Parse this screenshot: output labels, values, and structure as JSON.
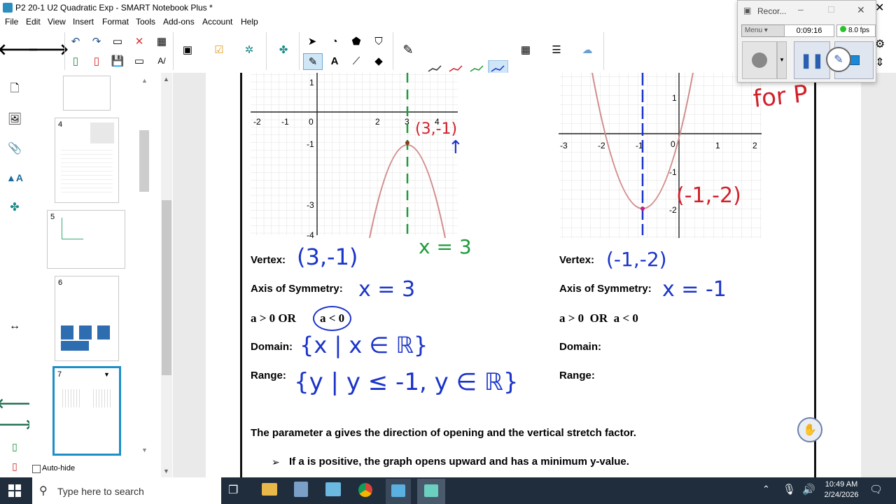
{
  "window": {
    "title": "P2 20-1 U2 Quadratic Exp - SMART Notebook Plus *",
    "close": "✕"
  },
  "menu": [
    "File",
    "Edit",
    "View",
    "Insert",
    "Format",
    "Tools",
    "Add-ons",
    "Account",
    "Help"
  ],
  "recorder": {
    "title": "Recor...",
    "menu_label": "Menu",
    "time": "0:09:16",
    "fps": "8.0 fps"
  },
  "sorter": {
    "pages": [
      {
        "num": "4"
      },
      {
        "num": "5"
      },
      {
        "num": "6"
      },
      {
        "num": "7"
      }
    ],
    "autohide": "Auto-hide"
  },
  "graph1": {
    "x_ticks": [
      "-2",
      "-1",
      "0",
      "2",
      "3",
      "4"
    ],
    "y_ticks": [
      "1",
      "-1",
      "-3",
      "-4"
    ],
    "vertex_ann": "(3,-1)",
    "axis_ann": "x = 3"
  },
  "graph2": {
    "x_ticks": [
      "-3",
      "-2",
      "-1",
      "0",
      "1",
      "2"
    ],
    "y_ticks": [
      "1",
      "-1",
      "-2"
    ],
    "vertex_ann": "(-1,-2)"
  },
  "left": {
    "vertex_label": "Vertex:",
    "vertex_value": "(3,-1)",
    "axis_label": "Axis of Symmetry:",
    "axis_value": "x = 3",
    "a_text": "a > 0  OR",
    "a_circled": "a < 0",
    "domain_label": "Domain:",
    "domain_value": "{x | x ∈ ℝ}",
    "range_label": "Range:",
    "range_value": "{y | y ≤ -1, y ∈ ℝ}"
  },
  "right": {
    "vertex_label": "Vertex:",
    "vertex_value": "(-1,-2)",
    "axis_label": "Axis of Symmetry:",
    "axis_value": "x = -1",
    "a_text": "a > 0  OR  a < 0",
    "domain_label": "Domain:",
    "range_label": "Range:"
  },
  "note_ink": "for P",
  "parameter_text": "The parameter a gives the direction of opening and the vertical stretch factor.",
  "bullet1": "If a is positive, the graph opens upward and has a minimum y-value.",
  "taskbar": {
    "search_placeholder": "Type here to search",
    "time": "10:49 AM",
    "date": "2/24/2026"
  },
  "colors": {
    "ink_blue": "#1a33c9",
    "ink_red": "#d2202a",
    "ink_green": "#1e9a3a",
    "curve": "#d28c8c"
  }
}
